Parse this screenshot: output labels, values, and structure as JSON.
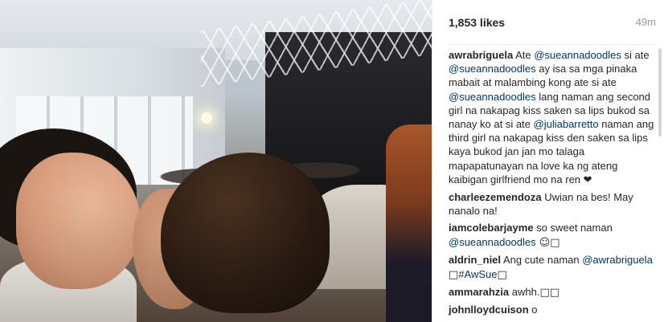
{
  "post": {
    "likes": "1,853 likes",
    "time": "49m"
  },
  "comments": [
    {
      "user": "awrabriguela",
      "parts": [
        {
          "t": "text",
          "v": "Ate "
        },
        {
          "t": "mention",
          "v": "@sueannadoodles"
        },
        {
          "t": "text",
          "v": " si ate "
        },
        {
          "t": "mention",
          "v": "@sueannadoodles"
        },
        {
          "t": "text",
          "v": " ay isa sa mga pinaka mabait at malambing kong ate si ate "
        },
        {
          "t": "mention",
          "v": "@sueannadoodles"
        },
        {
          "t": "text",
          "v": " lang naman ang second girl na nakapag kiss saken sa lips bukod sa nanay ko at si ate "
        },
        {
          "t": "mention",
          "v": "@juliabarretto"
        },
        {
          "t": "text",
          "v": " naman ang third girl na nakapag kiss den saken sa lips kaya bukod jan jan mo talaga mapapatunayan na love ka ng ateng kaibigan girlfriend mo na ren "
        },
        {
          "t": "glyph",
          "v": "❤"
        }
      ]
    },
    {
      "user": "charleezemendoza",
      "parts": [
        {
          "t": "text",
          "v": "Uwian na bes! May nanalo na!"
        }
      ]
    },
    {
      "user": "iamcolebarjayme",
      "parts": [
        {
          "t": "text",
          "v": "so sweet naman "
        },
        {
          "t": "mention",
          "v": "@sueannadoodles"
        },
        {
          "t": "glyph",
          "v": " ☺□"
        }
      ]
    },
    {
      "user": "aldrin_niel",
      "parts": [
        {
          "t": "text",
          "v": "Ang cute naman "
        },
        {
          "t": "mention",
          "v": "@awrabriguela"
        },
        {
          "t": "glyph",
          "v": " □"
        },
        {
          "t": "mention",
          "v": "#AwSue"
        },
        {
          "t": "glyph",
          "v": "□"
        }
      ]
    },
    {
      "user": "ammarahzia",
      "parts": [
        {
          "t": "text",
          "v": "awhh."
        },
        {
          "t": "glyph",
          "v": "□□"
        }
      ]
    },
    {
      "user": "johnlloydcuison",
      "parts": [
        {
          "t": "text",
          "v": "o"
        }
      ]
    }
  ],
  "colors": {
    "username": "#262626",
    "mention": "#003569",
    "meta": "#999999",
    "divider": "#efefef"
  },
  "icons": {
    "heart": "heart-emoji",
    "smile": "smile-emoji"
  }
}
